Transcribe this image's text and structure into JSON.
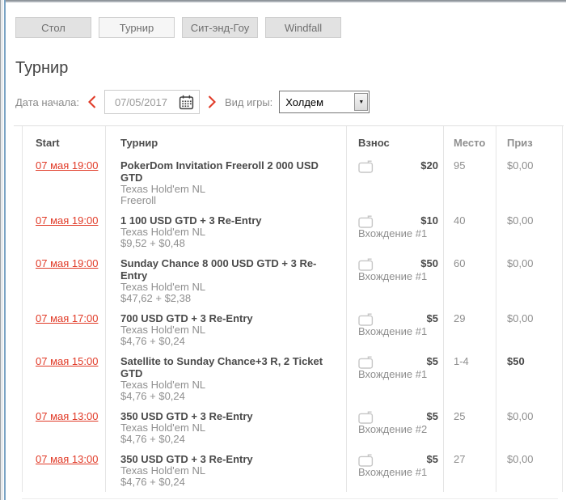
{
  "colors": {
    "accent_red": "#e13b28",
    "frame_blue": "#7aa3c4"
  },
  "tabs": [
    {
      "key": "table",
      "label": "Стол",
      "active": false
    },
    {
      "key": "tournament",
      "label": "Турнир",
      "active": true
    },
    {
      "key": "sit-and-go",
      "label": "Сит-энд-Гоу",
      "active": false
    },
    {
      "key": "windfall",
      "label": "Windfall",
      "active": false
    }
  ],
  "page_title": "Турнир",
  "filters": {
    "date_label": "Дата начала:",
    "date_value": "07/05/2017",
    "game_label": "Вид игры:",
    "game_value": "Холдем"
  },
  "table": {
    "columns": [
      "Start",
      "Турнир",
      "Взнос",
      "Место",
      "Приз"
    ],
    "rows": [
      {
        "start": "07 мая 19:00",
        "name": "PokerDom Invitation Freeroll 2 000 USD GTD",
        "game": "Texas Hold'em NL",
        "buyin_detail": "Freeroll",
        "fee": "$20",
        "entry": "",
        "place": "95",
        "prize": "$0,00",
        "prize_bold": false
      },
      {
        "start": "07 мая 19:00",
        "name": "1 100 USD GTD + 3 Re-Entry",
        "game": "Texas Hold'em NL",
        "buyin_detail": "$9,52 + $0,48",
        "fee": "$10",
        "entry": "Вхождение #1",
        "place": "40",
        "prize": "$0,00",
        "prize_bold": false
      },
      {
        "start": "07 мая 19:00",
        "name": "Sunday Chance 8 000 USD GTD + 3 Re-Entry",
        "game": "Texas Hold'em NL",
        "buyin_detail": "$47,62 + $2,38",
        "fee": "$50",
        "entry": "Вхождение #1",
        "place": "60",
        "prize": "$0,00",
        "prize_bold": false
      },
      {
        "start": "07 мая 17:00",
        "name": "700 USD GTD + 3 Re-Entry",
        "game": "Texas Hold'em NL",
        "buyin_detail": "$4,76 + $0,24",
        "fee": "$5",
        "entry": "Вхождение #1",
        "place": "29",
        "prize": "$0,00",
        "prize_bold": false
      },
      {
        "start": "07 мая 15:00",
        "name": "Satellite to Sunday Chance+3 R, 2 Ticket GTD",
        "game": "Texas Hold'em NL",
        "buyin_detail": "$4,76 + $0,24",
        "fee": "$5",
        "entry": "Вхождение #1",
        "place": "1-4",
        "prize": "$50",
        "prize_bold": true
      },
      {
        "start": "07 мая 13:00",
        "name": "350 USD GTD + 3 Re-Entry",
        "game": "Texas Hold'em NL",
        "buyin_detail": "$4,76 + $0,24",
        "fee": "$5",
        "entry": "Вхождение #2",
        "place": "25",
        "prize": "$0,00",
        "prize_bold": false
      },
      {
        "start": "07 мая 13:00",
        "name": "350 USD GTD + 3 Re-Entry",
        "game": "Texas Hold'em NL",
        "buyin_detail": "$4,76 + $0,24",
        "fee": "$5",
        "entry": "Вхождение #1",
        "place": "27",
        "prize": "$0,00",
        "prize_bold": false
      }
    ]
  }
}
